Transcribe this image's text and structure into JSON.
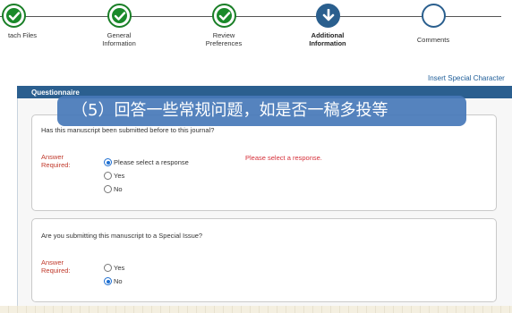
{
  "steps": [
    {
      "label": "tach Files",
      "state": "done"
    },
    {
      "label": "General\nInformation",
      "state": "done"
    },
    {
      "label": "Review\nPreferences",
      "state": "done"
    },
    {
      "label": "Additional\nInformation",
      "state": "current"
    },
    {
      "label": "Comments",
      "state": "todo"
    }
  ],
  "insert_link": "Insert Special Character",
  "panel_title": "Questionnaire",
  "caption": "（5）回答一些常规问题，如是否一稿多投等",
  "questions": [
    {
      "text": "Has this manuscript been submitted before to this journal?",
      "required_label": "Answer\nRequired:",
      "options": [
        {
          "label": "Please select a response",
          "selected": true
        },
        {
          "label": "Yes",
          "selected": false
        },
        {
          "label": "No",
          "selected": false
        }
      ],
      "error": "Please select a response."
    },
    {
      "text": "Are you submitting this manuscript to a Special Issue?",
      "required_label": "Answer\nRequired:",
      "options": [
        {
          "label": "Yes",
          "selected": false
        },
        {
          "label": "No",
          "selected": true
        }
      ]
    }
  ]
}
